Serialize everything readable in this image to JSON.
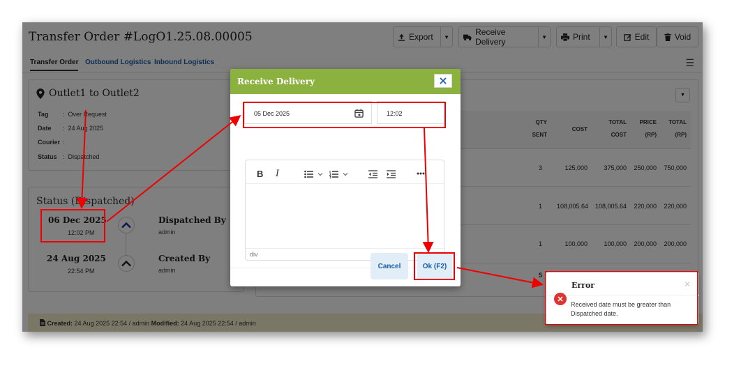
{
  "page": {
    "title": "Transfer Order #LogO1.25.08.00005",
    "buttons": {
      "export": "Export",
      "receive": "Receive Delivery",
      "print": "Print",
      "edit": "Edit",
      "void": "Void"
    },
    "tabs": [
      "Transfer Order",
      "Outbound Logistics",
      "Inbound Logistics"
    ],
    "route": "Outlet1 to Outlet2",
    "fields": {
      "tag_label": "Tag",
      "tag_value": "Over Request",
      "date_label": "Date",
      "date_value": "24 Aug 2025",
      "courier_label": "Courier",
      "courier_value": "",
      "status_label": "Status",
      "status_value": "Dispatched"
    },
    "status_section": {
      "title": "Status (Dispatched)",
      "events": [
        {
          "date": "06 Dec 2025",
          "time": "12:02 PM",
          "label": "Dispatched By",
          "user": "admin"
        },
        {
          "date": "24 Aug 2025",
          "time": "22:54 PM",
          "label": "Created By",
          "user": "admin"
        }
      ]
    },
    "table": {
      "headers": [
        [
          "QTY",
          "SENT"
        ],
        [
          "COST",
          ""
        ],
        [
          "TOTAL",
          "COST"
        ],
        [
          "PRICE",
          "(RP)"
        ],
        [
          "TOTAL",
          "(RP)"
        ]
      ],
      "rows": [
        [
          "3",
          "125,000",
          "375,000",
          "250,000",
          "750,000"
        ],
        [
          "1",
          "108,005.64",
          "108,005.64",
          "220,000",
          "220,000"
        ],
        [
          "1",
          "100,000",
          "100,000",
          "200,000",
          "200,000"
        ]
      ],
      "total_qty": "5"
    },
    "footer": {
      "created_label": "Created:",
      "created_value": "24 Aug 2025 22:54 / admin",
      "modified_label": "Modified:",
      "modified_value": "24 Aug 2025 22:54 / admin"
    }
  },
  "modal": {
    "title": "Receive Delivery",
    "date": "05 Dec 2025",
    "time": "12:02",
    "editor_status": "div",
    "cancel": "Cancel",
    "ok": "Ok (F2)"
  },
  "toast": {
    "title": "Error",
    "message": "Received date must be greater than Dispatched date."
  },
  "colors": {
    "modal_header": "#8bb13f",
    "error": "#dd3333",
    "annotation": "#ee0000",
    "link": "#1a5fa8",
    "footer_bg": "#f4efcc"
  }
}
